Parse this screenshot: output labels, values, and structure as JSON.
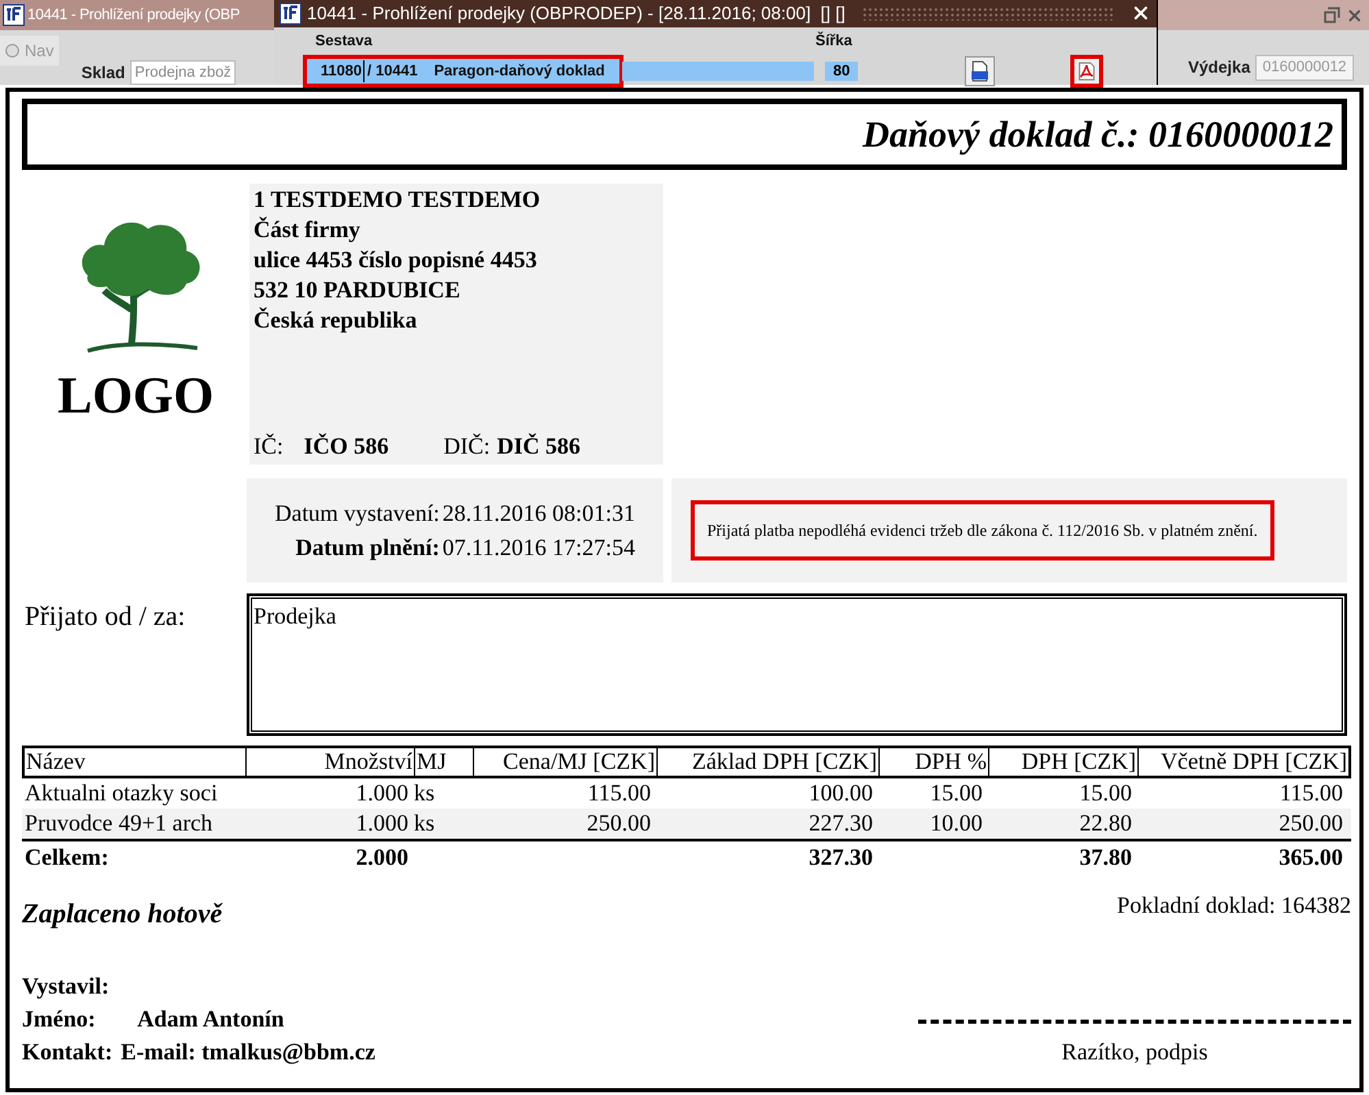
{
  "background_window": {
    "title": "10441 - Prohlížení prodejky (OBP",
    "nav_label": "Nav",
    "nav_selected": false,
    "sklad_label": "Sklad",
    "sklad_value": "Prodejna zbož",
    "vydejka_label": "Výdejka",
    "vydejka_value": "0160000012"
  },
  "dialog": {
    "title": "10441 - Prohlížení prodejky (OBPRODEP) - [28.11.2016; 08:00]  [] []",
    "sestava_label": "Sestava",
    "sestava_code": "11080",
    "sestava_id": "/ 10441",
    "sestava_name": "Paragon-daňový doklad",
    "sirka_label": "Šířka",
    "sirka_value": "80"
  },
  "document": {
    "title": "Daňový doklad č.: 0160000012",
    "logo_text": "LOGO",
    "company_lines": [
      "1 TESTDEMO TESTDEMO",
      "Část firmy",
      "ulice 4453 číslo popisné 4453",
      "532 10 PARDUBICE",
      "Česká republika"
    ],
    "ic_label": "IČ:",
    "ic_value": "IČO 586",
    "dic_label": "DIČ:",
    "dic_value": "DIČ 586",
    "dates": [
      {
        "label": "Datum vystavení:",
        "value": "28.11.2016 08:01:31",
        "bold": false
      },
      {
        "label": "Datum plnění:",
        "value": "07.11.2016 17:27:54",
        "bold": true
      }
    ],
    "notice": "Přijatá platba nepodléhá evidenci tržeb dle zákona č. 112/2016 Sb. v platném znění.",
    "received_label": "Přijato od / za:",
    "received_value": "Prodejka",
    "table": {
      "columns": [
        "Název",
        "Množství",
        "MJ",
        "Cena/MJ [CZK]",
        "Základ DPH [CZK]",
        "DPH %",
        "DPH [CZK]",
        "Včetně DPH [CZK]"
      ],
      "rows": [
        [
          "Aktualni otazky soci",
          "1.000",
          "ks",
          "115.00",
          "100.00",
          "15.00",
          "15.00",
          "115.00"
        ],
        [
          "Pruvodce 49+1 arch",
          "1.000",
          "ks",
          "250.00",
          "227.30",
          "10.00",
          "22.80",
          "250.00"
        ]
      ],
      "totals": {
        "label": "Celkem:",
        "quantity": "2.000",
        "base": "327.30",
        "vat": "37.80",
        "total": "365.00"
      }
    },
    "payment": "Zaplaceno hotově",
    "cash_doc": "Pokladní doklad: 164382",
    "issued_by": "Vystavil:",
    "name_label": "Jméno:",
    "name_value": "Adam Antonín",
    "contact_label": "Kontakt:",
    "contact_value": "E-mail: tmalkus@bbm.cz",
    "signature": "Razítko, podpis"
  }
}
